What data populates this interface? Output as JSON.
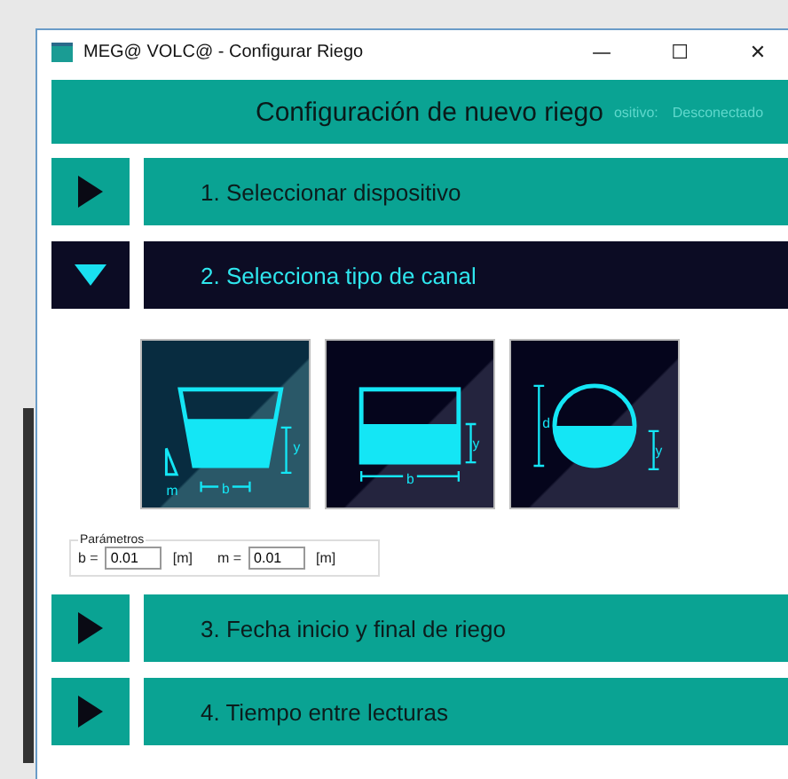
{
  "window": {
    "title": "MEG@ VOLC@ - Configurar Riego",
    "controls": [
      "—",
      "☐",
      "✕"
    ]
  },
  "header": {
    "title": "Configuración de nuevo riego",
    "status_label": "ositivo:",
    "status_value": "Desconectado"
  },
  "sections": [
    {
      "label": "1. Seleccionar dispositivo",
      "expanded": false
    },
    {
      "label": "2. Selecciona tipo de canal",
      "expanded": true
    },
    {
      "label": "3. Fecha inicio y final de riego",
      "expanded": false
    },
    {
      "label": "4. Tiempo entre lecturas",
      "expanded": false
    }
  ],
  "channel_types": [
    {
      "kind": "trapezoid",
      "selected": true,
      "labels": {
        "slope": "m",
        "width": "b",
        "depth": "y"
      }
    },
    {
      "kind": "rectangle",
      "selected": false,
      "labels": {
        "width": "b",
        "depth": "y"
      }
    },
    {
      "kind": "circle",
      "selected": false,
      "labels": {
        "diameter": "d",
        "depth": "y"
      }
    }
  ],
  "parameters": {
    "title": "Parámetros",
    "fields": [
      {
        "label": "b =",
        "value": "0.01",
        "unit": "[m]"
      },
      {
        "label": "m =",
        "value": "0.01",
        "unit": "[m]"
      }
    ]
  }
}
